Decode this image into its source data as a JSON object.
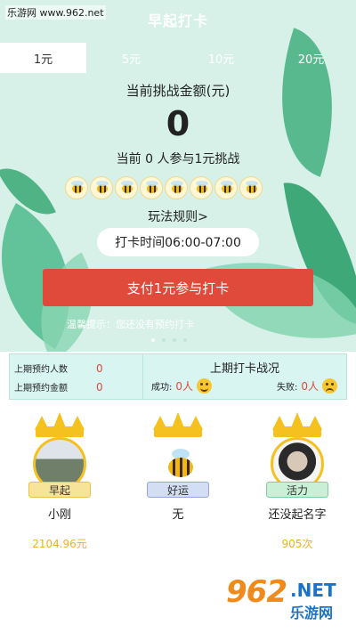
{
  "watermark": "乐游网 www.962.net",
  "header": {
    "title": "早起打卡"
  },
  "tabs": [
    {
      "label": "1元",
      "active": true
    },
    {
      "label": "5元",
      "active": false
    },
    {
      "label": "10元",
      "active": false
    },
    {
      "label": "20元",
      "active": false
    }
  ],
  "challenge": {
    "amount_label": "当前挑战金额(元)",
    "amount_value": "0",
    "participants_text": "当前 0 人参与1元挑战",
    "bee_count": 8,
    "rules_link": "玩法规则>",
    "time_window": "打卡时间06:00-07:00",
    "pay_button": "支付1元参与打卡",
    "tip": "温馨提示：您还没有预约打卡"
  },
  "carousel": {
    "pages": 4,
    "current": 1
  },
  "stats": {
    "prev_booking_count_label": "上期预约人数",
    "prev_booking_count_value": "0",
    "prev_booking_amount_label": "上期预约金额",
    "prev_booking_amount_value": "0",
    "result_title": "上期打卡战况",
    "success_label": "成功:",
    "success_value": "0人",
    "fail_label": "失败:",
    "fail_value": "0人"
  },
  "leaders": [
    {
      "badge": "早起",
      "name": "小刚",
      "value": "2104.96元"
    },
    {
      "badge": "好运",
      "name": "无",
      "value": ""
    },
    {
      "badge": "活力",
      "name": "还没起名字",
      "value": "905次"
    }
  ],
  "logo": {
    "big": "962",
    "net": ".NET",
    "cn": "乐游网"
  },
  "colors": {
    "accent_red": "#e04a3a",
    "hero_bg": "#d7f1e9",
    "gold": "#f4c11e"
  }
}
